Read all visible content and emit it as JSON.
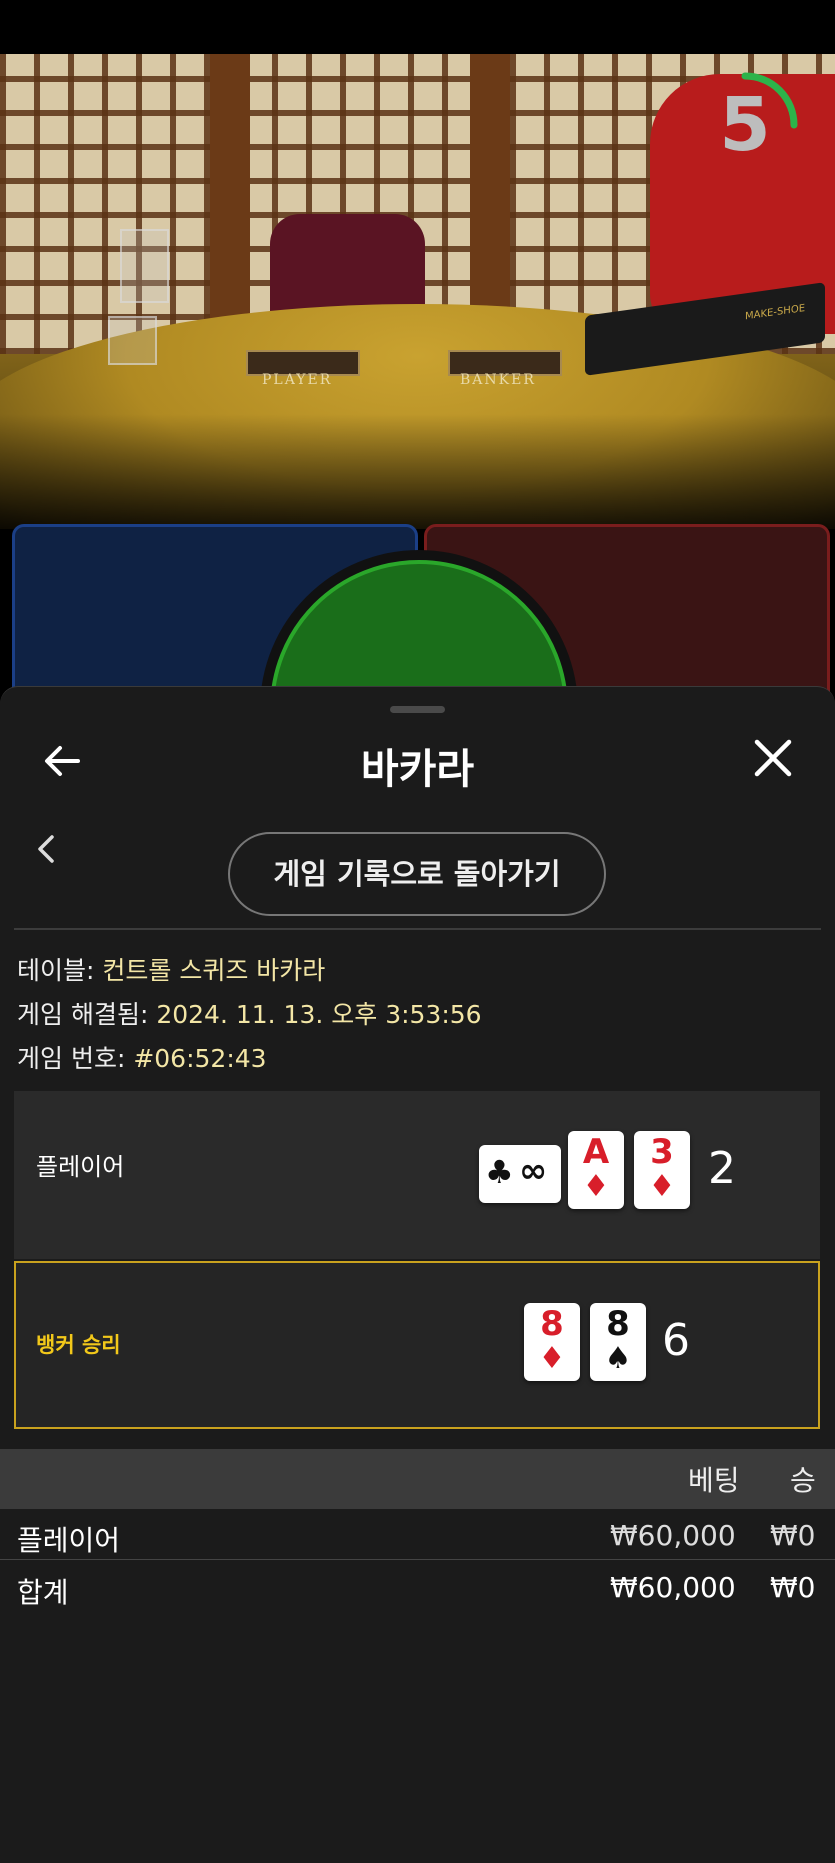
{
  "video": {
    "timer": "5",
    "table_labels": {
      "player": "PLAYER",
      "banker": "BANKER"
    },
    "shoe_label": "MAKE-SHOE"
  },
  "sheet": {
    "title": "바카라",
    "back_to_history": "게임 기록으로 돌아가기",
    "info": [
      {
        "label": "테이블: ",
        "value": "컨트롤 스퀴즈 바카라"
      },
      {
        "label": "게임 해결됨: ",
        "value": "2024. 11. 13. 오후 3:53:56"
      },
      {
        "label": "게임 번호: ",
        "value": "#06:52:43"
      }
    ],
    "hands": {
      "player": {
        "label": "플레이어",
        "score": "2",
        "cards": [
          {
            "rank": "∞",
            "suit": "♣",
            "color": "#111111",
            "rotated": true
          },
          {
            "rank": "A",
            "suit": "♦",
            "color": "#d81e2a"
          },
          {
            "rank": "3",
            "suit": "♦",
            "color": "#d81e2a"
          }
        ]
      },
      "banker": {
        "label": "뱅커 승리",
        "score": "6",
        "cards": [
          {
            "rank": "8",
            "suit": "♦",
            "color": "#d81e2a"
          },
          {
            "rank": "8",
            "suit": "♠",
            "color": "#111111"
          }
        ]
      }
    },
    "bets": {
      "headers": {
        "bet": "베팅",
        "win": "승"
      },
      "rows": [
        {
          "name": "플레이어",
          "bet": "₩60,000",
          "win": "₩0"
        },
        {
          "name": "합계",
          "bet": "₩60,000",
          "win": "₩0"
        }
      ]
    }
  },
  "colors": {
    "accent_gold": "#c9a21e",
    "value_text": "#f3e6a6",
    "sheet_bg": "#1b1b1b",
    "player_blue": "#1b3f87",
    "banker_red": "#7a1d1d",
    "tie_green": "#2aa72a"
  },
  "icons": [
    "back-arrow-icon",
    "close-icon",
    "chevron-left-icon",
    "club-suit-icon",
    "diamond-suit-icon",
    "spade-suit-icon"
  ]
}
